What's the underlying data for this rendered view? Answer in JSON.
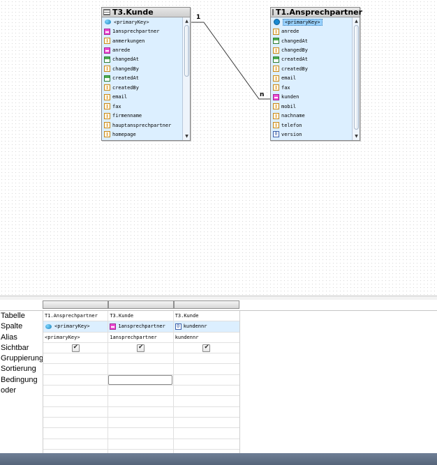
{
  "diagram": {
    "relation": {
      "from_cardinality": "1",
      "to_cardinality": "n"
    },
    "tables": [
      {
        "title": "T3.Kunde",
        "fields": [
          {
            "icon": "primary-key-icon",
            "label": "<primaryKey>"
          },
          {
            "icon": "relation-icon",
            "label": "1ansprechpartner"
          },
          {
            "icon": "text-field-icon",
            "label": "anmerkungen"
          },
          {
            "icon": "relation-icon",
            "label": "anrede"
          },
          {
            "icon": "date-field-icon",
            "label": "changedAt"
          },
          {
            "icon": "text-field-icon",
            "label": "changedBy"
          },
          {
            "icon": "date-field-icon",
            "label": "createdAt"
          },
          {
            "icon": "text-field-icon",
            "label": "createdBy"
          },
          {
            "icon": "text-field-icon",
            "label": "email"
          },
          {
            "icon": "text-field-icon",
            "label": "fax"
          },
          {
            "icon": "text-field-icon",
            "label": "firmenname"
          },
          {
            "icon": "text-field-icon",
            "label": "hauptansprechpartner"
          },
          {
            "icon": "text-field-icon",
            "label": "homepage"
          }
        ]
      },
      {
        "title": "T1.Ansprechpartner",
        "fields": [
          {
            "icon": "primary-key-icon",
            "label": "<primaryKey>",
            "selected": true
          },
          {
            "icon": "text-field-icon",
            "label": "anrede"
          },
          {
            "icon": "date-field-icon",
            "label": "changedAt"
          },
          {
            "icon": "text-field-icon",
            "label": "changedBy"
          },
          {
            "icon": "date-field-icon",
            "label": "createdAt"
          },
          {
            "icon": "text-field-icon",
            "label": "createdBy"
          },
          {
            "icon": "text-field-icon",
            "label": "email"
          },
          {
            "icon": "text-field-icon",
            "label": "fax"
          },
          {
            "icon": "relation-icon",
            "label": "kunden"
          },
          {
            "icon": "text-field-icon",
            "label": "mobil"
          },
          {
            "icon": "text-field-icon",
            "label": "nachname"
          },
          {
            "icon": "text-field-icon",
            "label": "telefon"
          },
          {
            "icon": "number-field-icon",
            "label": "version"
          }
        ]
      }
    ]
  },
  "query_grid": {
    "row_labels": [
      "Tabelle",
      "Spalte",
      "Alias",
      "Sichtbar",
      "Gruppierung",
      "Sortierung",
      "Bedingung",
      "oder"
    ],
    "columns": [
      {
        "tabelle": "T1.Ansprechpartner",
        "spalte": "<primaryKey>",
        "spalte_icon": "primary-key-icon",
        "alias": "<primaryKey>",
        "sichtbar": true
      },
      {
        "tabelle": "T3.Kunde",
        "spalte": "1ansprechpartner",
        "spalte_icon": "relation-icon",
        "alias": "1ansprechpartner",
        "sichtbar": true
      },
      {
        "tabelle": "T3.Kunde",
        "spalte": "kundennr",
        "spalte_icon": "number-field-icon",
        "alias": "kundennr",
        "sichtbar": true
      }
    ],
    "number_icon_glyph": "0"
  }
}
